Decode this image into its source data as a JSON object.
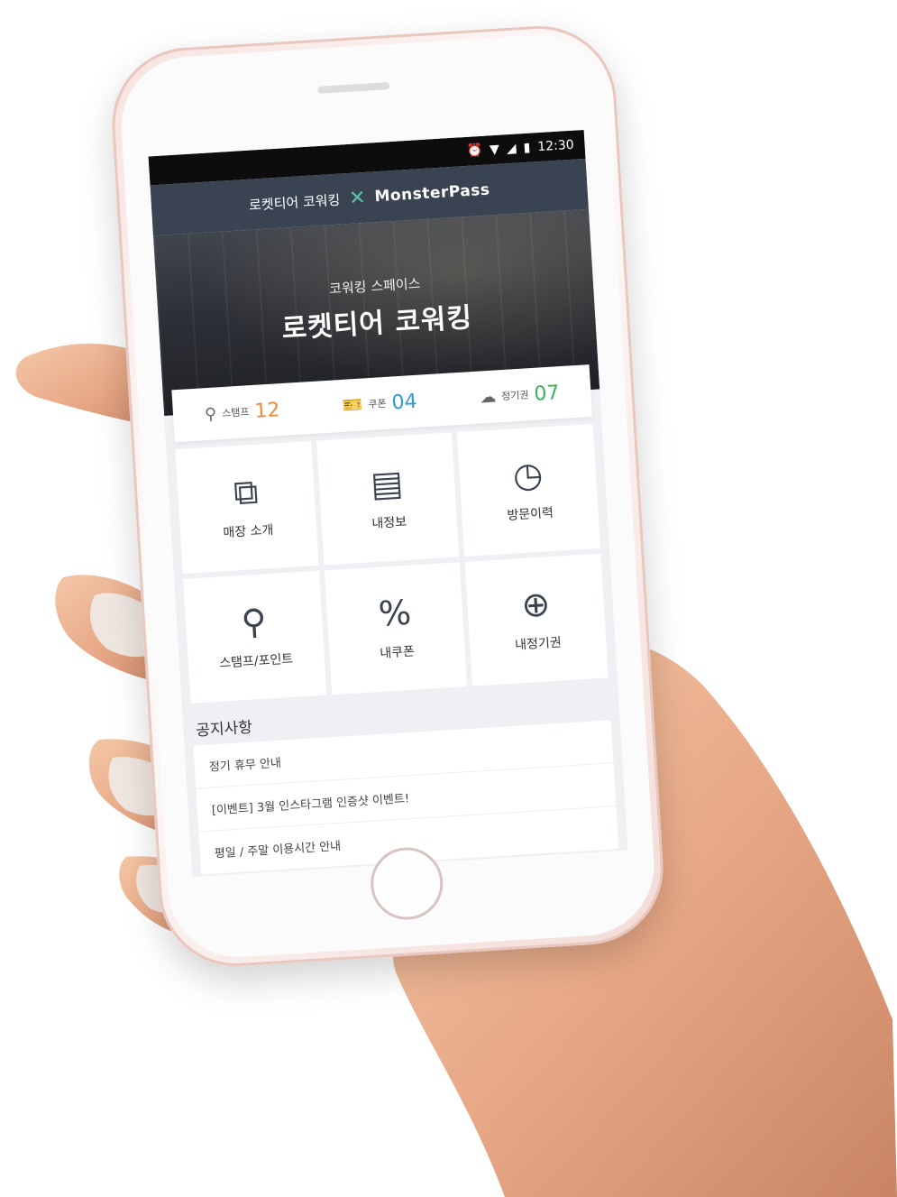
{
  "status_bar": {
    "time": "12:30",
    "icons": [
      "alarm-icon",
      "wifi-icon",
      "signal-icon",
      "battery-icon"
    ]
  },
  "header": {
    "partner": "로켓티어 코워킹",
    "separator": "✕",
    "brand": "MonsterPass"
  },
  "hero": {
    "subtitle": "코워킹 스페이스",
    "title": "로켓티어 코워킹"
  },
  "stats": [
    {
      "icon": "stamp-icon",
      "label": "스탬프",
      "value": "12",
      "color": "#f28a3c"
    },
    {
      "icon": "coupon-icon",
      "label": "쿠폰",
      "value": "04",
      "color": "#2f9bd8"
    },
    {
      "icon": "pass-icon",
      "label": "정기권",
      "value": "07",
      "color": "#3cb35a"
    }
  ],
  "tiles": [
    {
      "icon": "puzzle-icon",
      "label": "매장 소개"
    },
    {
      "icon": "id-card-icon",
      "label": "내정보"
    },
    {
      "icon": "history-clock-icon",
      "label": "방문이력"
    },
    {
      "icon": "stamp-check-icon",
      "label": "스탬프/포인트"
    },
    {
      "icon": "coupon-percent-icon",
      "label": "내쿠폰"
    },
    {
      "icon": "ticket-plus-icon",
      "label": "내정기권"
    }
  ],
  "notices": {
    "title": "공지사항",
    "items": [
      "정기 휴무 안내",
      "[이벤트] 3월 인스타그램 인증샷 이벤트!",
      "평일 / 주말 이용시간 안내"
    ]
  }
}
